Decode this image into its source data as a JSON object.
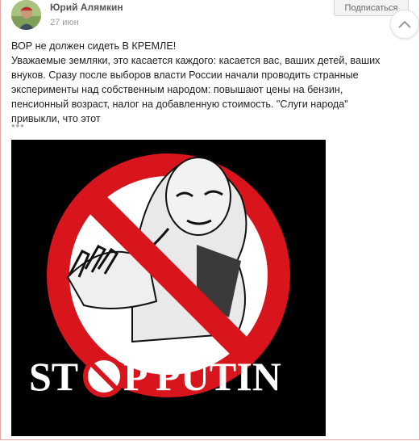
{
  "post": {
    "author": "Юрий Алямкин",
    "date": "27 июн",
    "subscribe_label": "Подписаться",
    "title": "ВОР не должен сидеть В КРЕМЛЕ!",
    "body": " Уважаемые земляки, это касается каждого: касается вас, ваших детей, ваших внуков. Сразу после выборов власти России начали проводить странные эксперименты над собственным народом: повышают цены на бензин, пенсионный возраст, налог на добавленную стоимость. \"Слуги народа\" привыкли, что этот",
    "more": "•••"
  },
  "image": {
    "caption_left": "ST",
    "caption_right": "P PUTIN"
  },
  "icons": {
    "scroll_up": "chevron-up-icon"
  },
  "colors": {
    "sign_red": "#d8141c",
    "image_bg": "#000000",
    "border": "#e3a9a9"
  }
}
